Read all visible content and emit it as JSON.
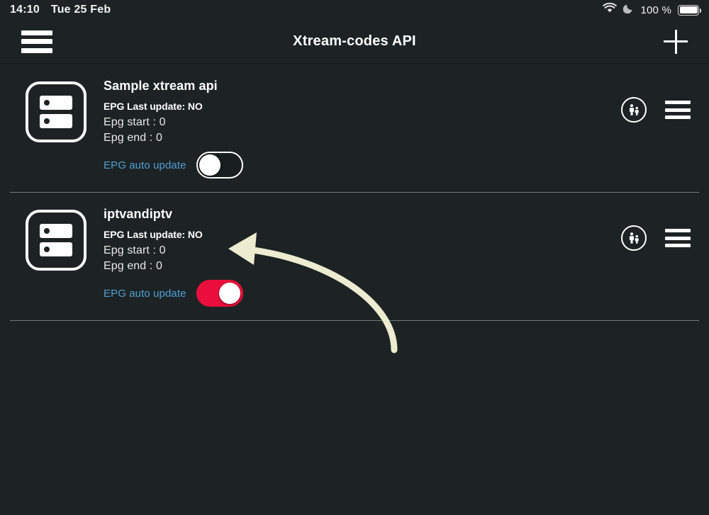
{
  "statusbar": {
    "time": "14:10",
    "date": "Tue 25 Feb",
    "battery_pct": "100 %",
    "wifi_icon": "wifi-icon",
    "dnd_icon": "moon-icon",
    "battery_icon": "battery-full-icon"
  },
  "appbar": {
    "title": "Xtream-codes API",
    "menu_icon": "hamburger-menu-icon",
    "add_icon": "plus-icon"
  },
  "theme": {
    "background": "#1d2324",
    "text": "#ffffff",
    "link_blue": "#4f9fd6",
    "toggle_on": "#ea0f3c",
    "divider": "#6e7a7c",
    "annotation_arrow": "#edebd0"
  },
  "list": {
    "items": [
      {
        "icon": "server-icon",
        "title": "Sample xtream api",
        "epg_last_update": "EPG Last update: NO",
        "epg_start": "Epg start : 0",
        "epg_end": "Epg end : 0",
        "auto_update_label": "EPG auto update",
        "auto_update_state": "off",
        "parental_icon": "parental-control-icon",
        "menu_icon": "row-menu-icon"
      },
      {
        "icon": "server-icon",
        "title": "iptvandiptv",
        "epg_last_update": "EPG Last update: NO",
        "epg_start": "Epg start : 0",
        "epg_end": "Epg end : 0",
        "auto_update_label": "EPG auto update",
        "auto_update_state": "on",
        "parental_icon": "parental-control-icon",
        "menu_icon": "row-menu-icon"
      }
    ]
  },
  "annotation": {
    "type": "curved-arrow",
    "points_to": "EPG auto update toggle of iptvandiptv",
    "color": "#edebd0"
  }
}
